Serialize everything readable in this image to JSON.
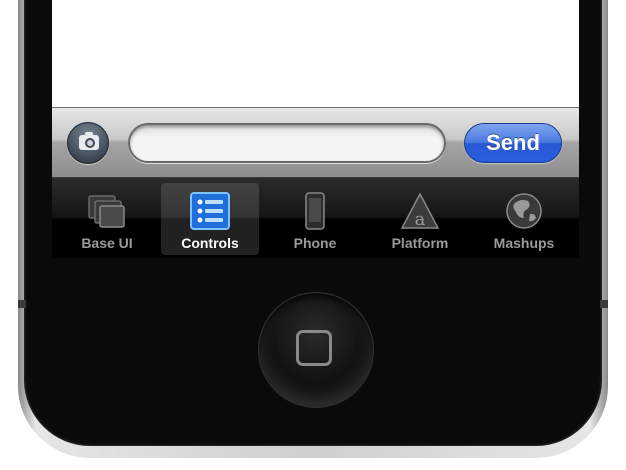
{
  "input_bar": {
    "message_value": "",
    "send_label": "Send",
    "camera_icon": "camera-icon"
  },
  "tab_bar": {
    "tabs": [
      {
        "label": "Base UI",
        "icon": "base-ui-icon",
        "selected": false
      },
      {
        "label": "Controls",
        "icon": "controls-list-icon",
        "selected": true
      },
      {
        "label": "Phone",
        "icon": "phone-icon",
        "selected": false
      },
      {
        "label": "Platform",
        "icon": "platform-icon",
        "selected": false
      },
      {
        "label": "Mashups",
        "icon": "globe-icon",
        "selected": false
      }
    ]
  },
  "device": {
    "home_button_icon": "home-button-icon"
  },
  "colors": {
    "send_button": "#2a5fe0",
    "tab_bar": "#000000",
    "selected_tab_icon": "#3aa0ff"
  }
}
